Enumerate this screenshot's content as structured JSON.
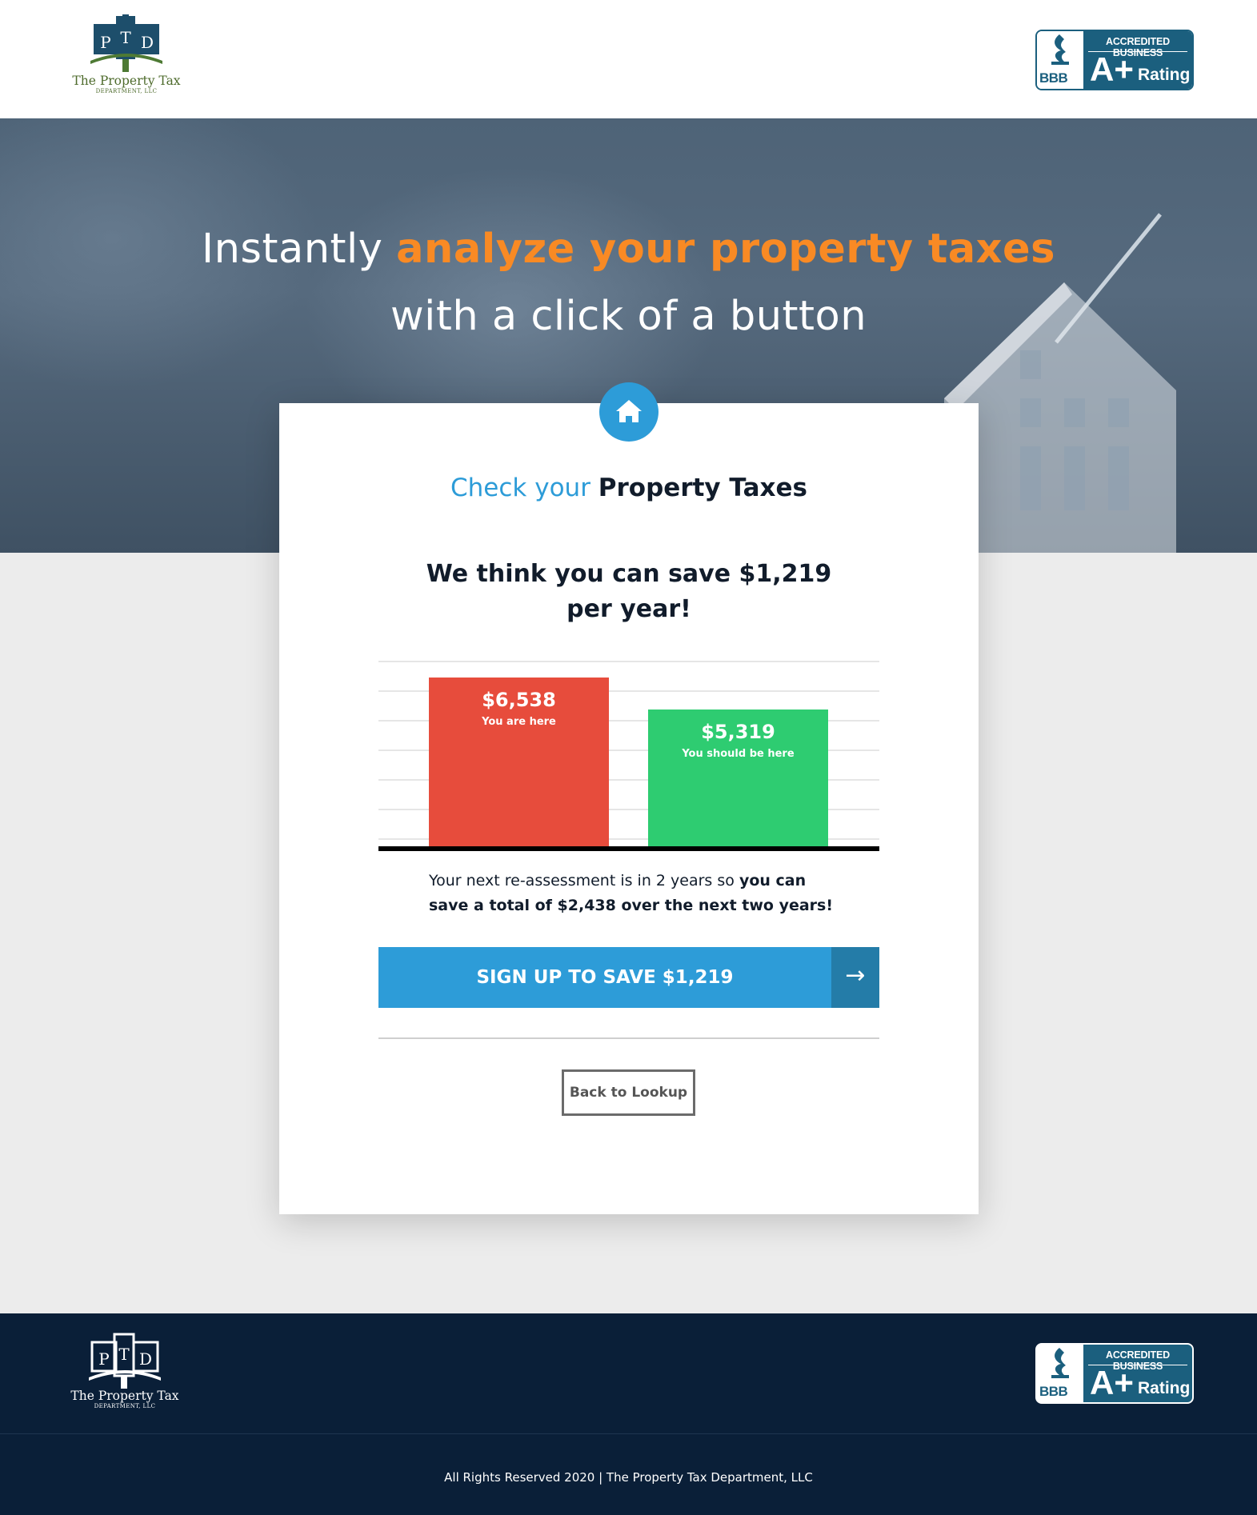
{
  "header": {
    "logo": {
      "mark": "PTD",
      "name": "The Property Tax",
      "sub": "Department, LLC"
    },
    "bbb": {
      "seal": "BBB",
      "accredited": "ACCREDITED BUSINESS",
      "grade": "A+",
      "rating": "Rating"
    }
  },
  "hero": {
    "title_pre": "Instantly",
    "title_highlight": "analyze your property taxes",
    "title_line2": "with a click of a button"
  },
  "card": {
    "icon": "home-icon",
    "title_light": "Check your",
    "title_bold": "Property Taxes",
    "headline": "We think you can save $1,219 per year!",
    "note_plain": "Your next re-assessment is in 2 years so",
    "note_bold": "you can save a total of $2,438 over the next two years!",
    "cta_label": "SIGN UP TO SAVE $1,219",
    "cta_icon": "arrow-right-icon",
    "cta_arrow": "→",
    "back_label": "Back to Lookup"
  },
  "chart_data": {
    "type": "bar",
    "categories": [
      "You are here",
      "You should be here"
    ],
    "values": [
      6538,
      5319
    ],
    "value_labels": [
      "$6,538",
      "$5,319"
    ],
    "colors": [
      "#e74c3c",
      "#2ecc71"
    ],
    "ylim": [
      0,
      7200
    ],
    "grid": true
  },
  "footer": {
    "logo": {
      "mark": "PTD",
      "name": "The Property Tax",
      "sub": "Department, LLC"
    },
    "bbb": {
      "seal": "BBB",
      "accredited": "ACCREDITED BUSINESS",
      "grade": "A+",
      "rating": "Rating"
    },
    "copyright": "All Rights Reserved 2020 | The Property Tax Department, LLC"
  },
  "colors": {
    "accent": "#2d9cd8",
    "highlight": "#f98a24",
    "navy": "#0a1f38",
    "bbb_blue": "#1b5f7e"
  }
}
